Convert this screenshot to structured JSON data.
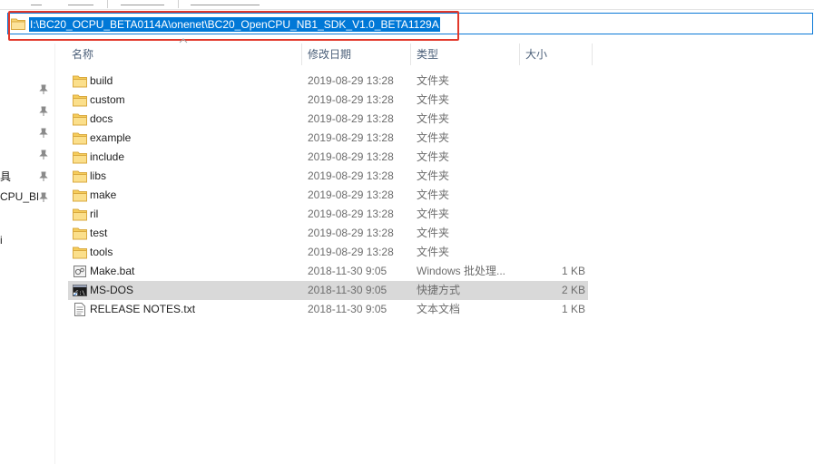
{
  "address_bar": {
    "path": "I:\\BC20_OCPU_BETA0114A\\onenet\\BC20_OpenCPU_NB1_SDK_V1.0_BETA1129A",
    "folder_icon": "folder-icon"
  },
  "nav_pane": {
    "fragments": [
      "具",
      "CPU_BE",
      "i"
    ],
    "pin_icon": "pin-icon"
  },
  "columns": {
    "name": "名称",
    "date": "修改日期",
    "type": "类型",
    "size": "大小"
  },
  "files": [
    {
      "name": "build",
      "date": "2019-08-29 13:28",
      "type": "文件夹",
      "size": "",
      "icon": "folder-icon"
    },
    {
      "name": "custom",
      "date": "2019-08-29 13:28",
      "type": "文件夹",
      "size": "",
      "icon": "folder-icon"
    },
    {
      "name": "docs",
      "date": "2019-08-29 13:28",
      "type": "文件夹",
      "size": "",
      "icon": "folder-icon"
    },
    {
      "name": "example",
      "date": "2019-08-29 13:28",
      "type": "文件夹",
      "size": "",
      "icon": "folder-icon"
    },
    {
      "name": "include",
      "date": "2019-08-29 13:28",
      "type": "文件夹",
      "size": "",
      "icon": "folder-icon"
    },
    {
      "name": "libs",
      "date": "2019-08-29 13:28",
      "type": "文件夹",
      "size": "",
      "icon": "folder-icon"
    },
    {
      "name": "make",
      "date": "2019-08-29 13:28",
      "type": "文件夹",
      "size": "",
      "icon": "folder-icon"
    },
    {
      "name": "ril",
      "date": "2019-08-29 13:28",
      "type": "文件夹",
      "size": "",
      "icon": "folder-icon"
    },
    {
      "name": "test",
      "date": "2019-08-29 13:28",
      "type": "文件夹",
      "size": "",
      "icon": "folder-icon"
    },
    {
      "name": "tools",
      "date": "2019-08-29 13:28",
      "type": "文件夹",
      "size": "",
      "icon": "folder-icon"
    },
    {
      "name": "Make.bat",
      "date": "2018-11-30 9:05",
      "type": "Windows 批处理...",
      "size": "1 KB",
      "icon": "batch-file-icon"
    },
    {
      "name": "MS-DOS",
      "date": "2018-11-30 9:05",
      "type": "快捷方式",
      "size": "2 KB",
      "icon": "console-shortcut-icon",
      "selected": true
    },
    {
      "name": "RELEASE NOTES.txt",
      "date": "2018-11-30 9:05",
      "type": "文本文档",
      "size": "1 KB",
      "icon": "text-file-icon"
    }
  ],
  "colors": {
    "selection": "#0078d7",
    "highlight_box": "#e2382b",
    "row_selected": "#d9d9d9",
    "header_text": "#4c607a"
  }
}
